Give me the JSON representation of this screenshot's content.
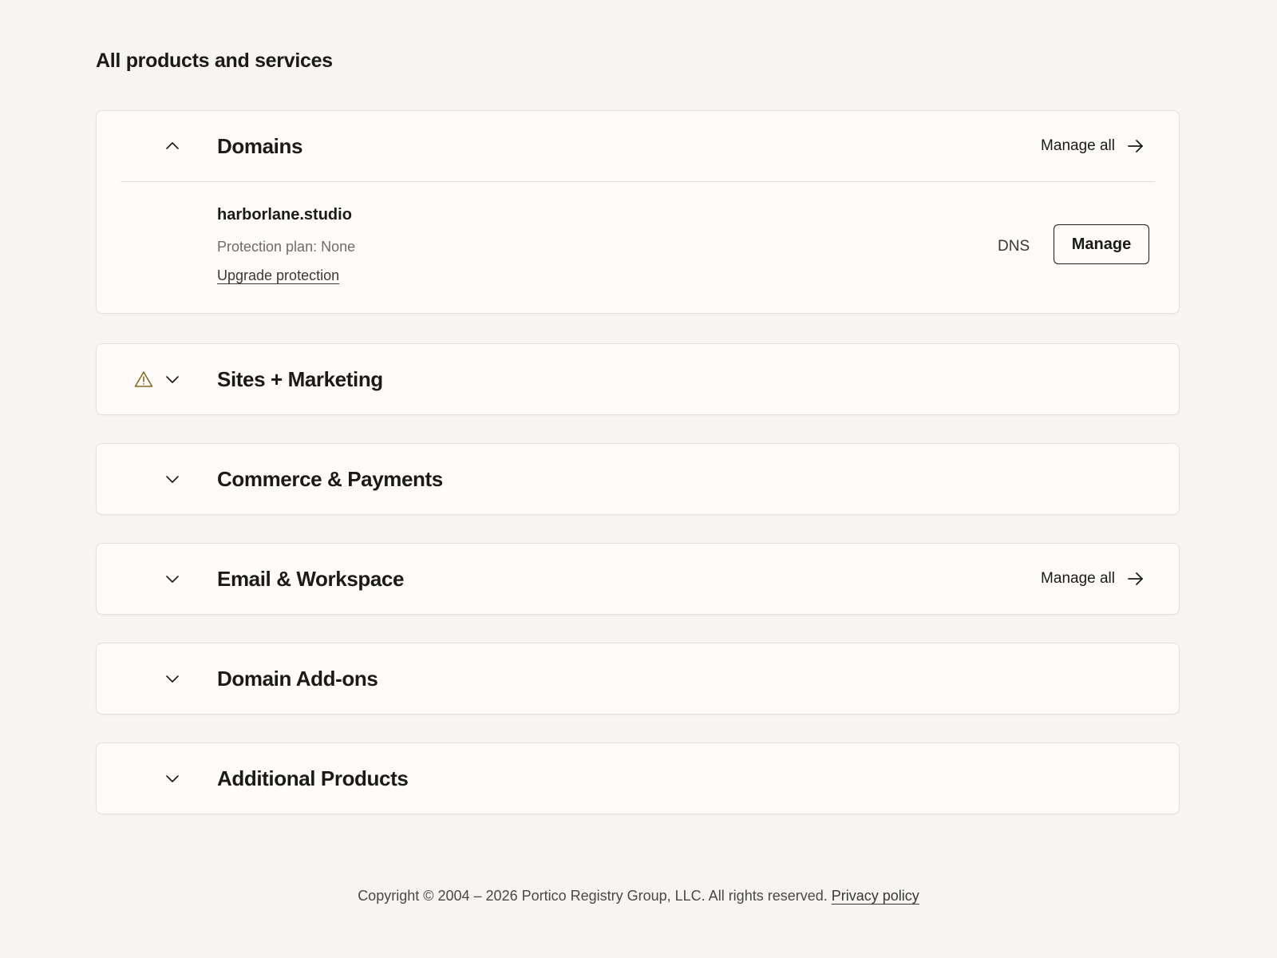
{
  "page": {
    "title": "All products and services"
  },
  "sections": [
    {
      "title": "Domains",
      "expanded": true,
      "manage_all_label": "Manage all",
      "domain": {
        "name": "harborlane.studio",
        "protection": "Protection plan: None",
        "upgrade_label": "Upgrade protection",
        "dns_label": "DNS",
        "manage_label": "Manage"
      }
    },
    {
      "title": "Sites + Marketing",
      "expanded": false,
      "warning": true
    },
    {
      "title": "Commerce & Payments",
      "expanded": false
    },
    {
      "title": "Email & Workspace",
      "expanded": false,
      "manage_all_label": "Manage all"
    },
    {
      "title": "Domain Add-ons",
      "expanded": false
    },
    {
      "title": "Additional Products",
      "expanded": false
    }
  ],
  "footer": {
    "copyright": "Copyright © 2004 – 2026 Portico Registry Group, LLC. All rights reserved.",
    "privacy_label": "Privacy policy"
  },
  "icons": {
    "warning": "warning-triangle-icon",
    "chevron_up": "chevron-up-icon",
    "chevron_down": "chevron-down-icon",
    "arrow_right": "arrow-right-icon"
  },
  "colors": {
    "background": "#f6f5f2",
    "card": "#fdfcfa",
    "text": "#1b1a17",
    "muted": "#6f6c66",
    "warning": "#8a6a1e",
    "border": "#e4e1db"
  }
}
